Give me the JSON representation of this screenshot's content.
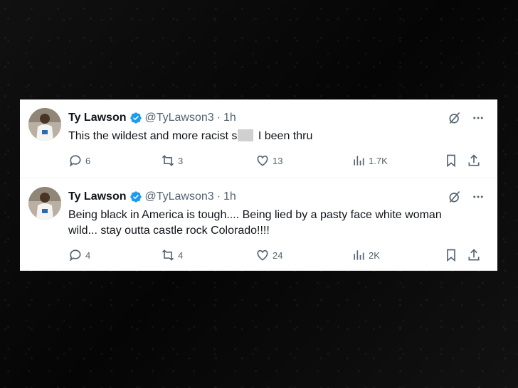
{
  "tweets": [
    {
      "author": "Ty Lawson",
      "handle": "@TyLawson3",
      "separator": "·",
      "time": "1h",
      "text_before": "This the wildest and more racist s",
      "text_after": " I been thru",
      "redacted": true,
      "replies": "6",
      "reposts": "3",
      "likes": "13",
      "views": "1.7K"
    },
    {
      "author": "Ty Lawson",
      "handle": "@TyLawson3",
      "separator": "·",
      "time": "1h",
      "line1": "Being black in America is tough.... Being lied by a pasty face white woman",
      "line2": "wild... stay outta castle rock Colorado!!!!",
      "replies": "4",
      "reposts": "4",
      "likes": "24",
      "views": "2K"
    }
  ],
  "colors": {
    "verified": "#1d9bf0",
    "text": "#0f1419",
    "muted": "#536471",
    "background": "#0a0a0a"
  },
  "icons": [
    "verified-badge-icon",
    "grok-icon",
    "more-icon",
    "reply-icon",
    "repost-icon",
    "like-icon",
    "views-icon",
    "bookmark-icon",
    "share-icon"
  ]
}
